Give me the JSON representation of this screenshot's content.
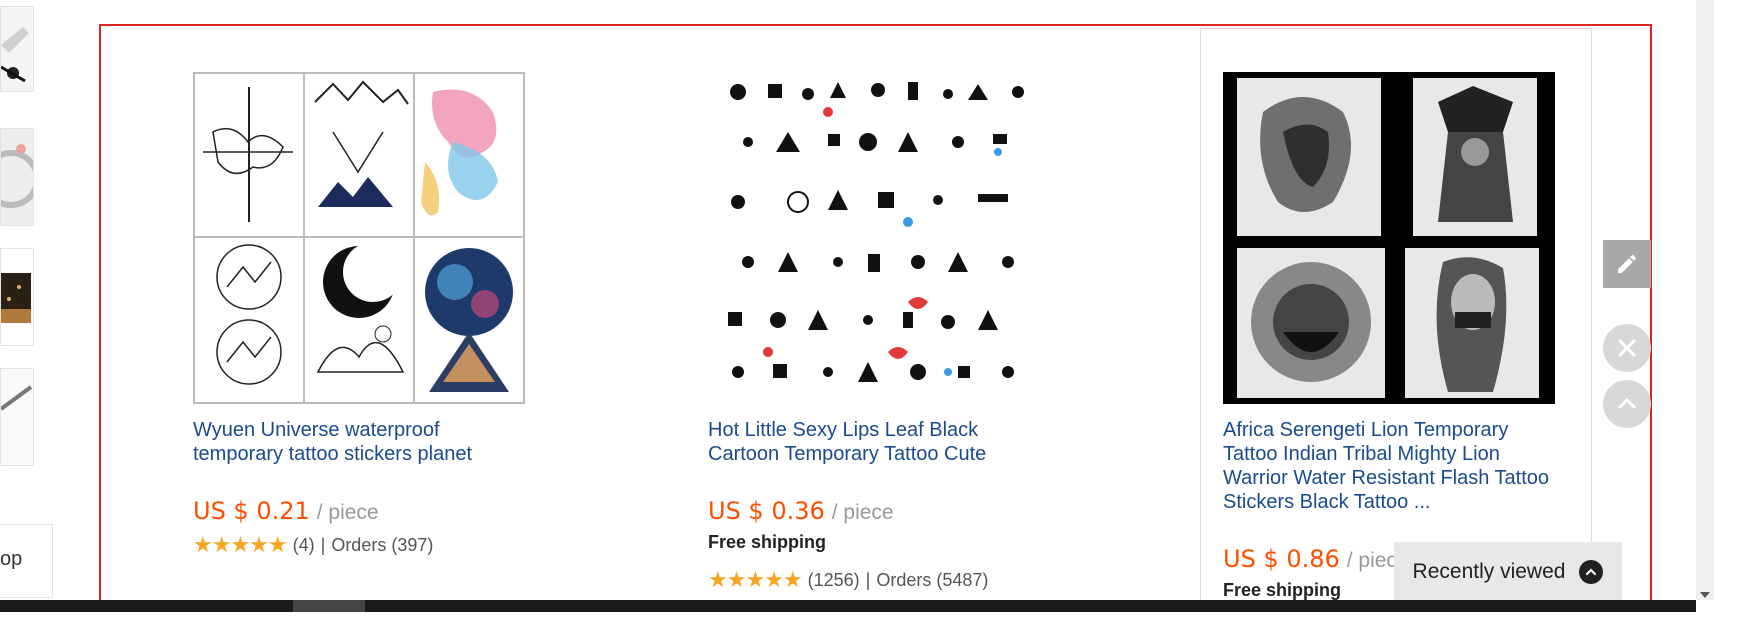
{
  "left_panel": {
    "shop_label": "op"
  },
  "products": [
    {
      "title": "Wyuen Universe waterproof temporary tattoo stickers planet",
      "price": "US $ 0.21",
      "unit": "/ piece",
      "shipping": "",
      "stars": "★★★★★",
      "review_count": "(4)",
      "separator": "|",
      "orders": "Orders (397)"
    },
    {
      "title": "Hot Little Sexy Lips Leaf Black Cartoon Temporary Tattoo Cute",
      "price": "US $ 0.36",
      "unit": "/ piece",
      "shipping": "Free shipping",
      "stars": "★★★★★",
      "review_count": "(1256)",
      "separator": "|",
      "orders": "Orders (5487)"
    },
    {
      "title": "Africa Serengeti Lion Temporary Tattoo Indian Tribal Mighty Lion Warrior Water Resistant Flash Tattoo Stickers Black Tattoo ...",
      "price": "US $ 0.86",
      "unit": "/ piece",
      "shipping": "Free shipping"
    }
  ],
  "floating": {
    "recently_viewed": "Recently viewed"
  },
  "colors": {
    "price": "#ff4e00",
    "title_link": "#1a4b8c",
    "frame_border": "#e02424",
    "star": "#f5a623"
  },
  "icons": [
    "pencil-icon",
    "close-icon",
    "chevron-up-icon",
    "scroll-down-arrow-icon"
  ]
}
